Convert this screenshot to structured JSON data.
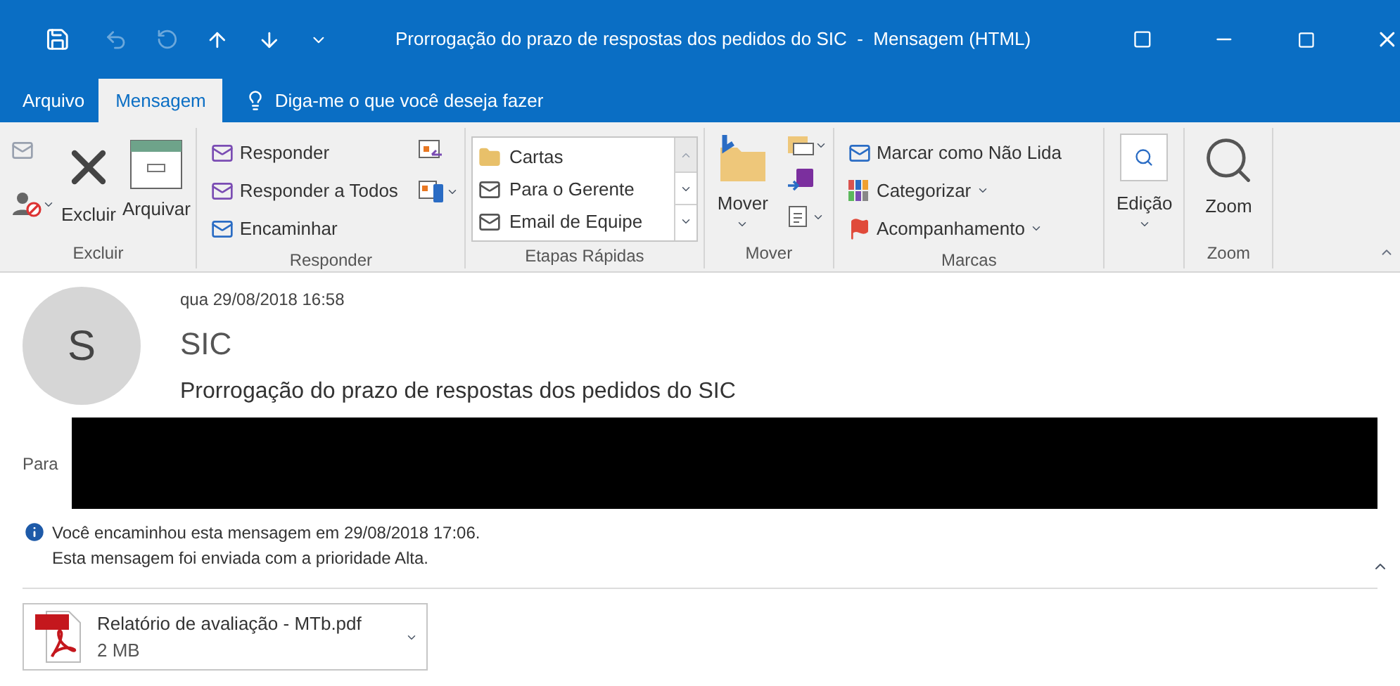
{
  "window": {
    "title": "Prorrogação do prazo de respostas dos pedidos do SIC  -  Mensagem (HTML)"
  },
  "tabs": [
    {
      "label": "Arquivo",
      "selected": false
    },
    {
      "label": "Mensagem",
      "selected": true
    }
  ],
  "tell_me": {
    "placeholder": "Diga-me o que você deseja fazer"
  },
  "ribbon": {
    "groups": [
      {
        "kind": "delete",
        "label": "Excluir",
        "buttons": [
          "Excluir",
          "Arquivar"
        ]
      },
      {
        "kind": "respond",
        "label": "Responder",
        "buttons": [
          "Responder",
          "Responder a Todos",
          "Encaminhar"
        ]
      },
      {
        "kind": "quicksteps",
        "label": "Etapas Rápidas",
        "buttons": [
          "Cartas",
          "Para o Gerente",
          "Email de Equipe"
        ]
      },
      {
        "kind": "move",
        "label": "Mover",
        "buttons": [
          "Mover"
        ]
      },
      {
        "kind": "tags",
        "label": "Marcas",
        "buttons": [
          "Marcar como Não Lida",
          "Categorizar",
          "Acompanhamento"
        ]
      },
      {
        "kind": "editing",
        "buttons": [
          "Edição"
        ]
      },
      {
        "kind": "zoom",
        "label": "Zoom",
        "buttons": [
          "Zoom"
        ]
      }
    ]
  },
  "message": {
    "date": "qua 29/08/2018 16:58",
    "avatar_letter": "S",
    "sender": "SIC",
    "subject": "Prorrogação do prazo de respostas dos pedidos do SIC",
    "to_label": "Para",
    "info": [
      "Você encaminhou esta mensagem em 29/08/2018 17:06.",
      "Esta mensagem foi enviada com a prioridade Alta."
    ],
    "attachment": {
      "name": "Relatório de avaliação - MTb.pdf",
      "size": "2 MB"
    }
  }
}
